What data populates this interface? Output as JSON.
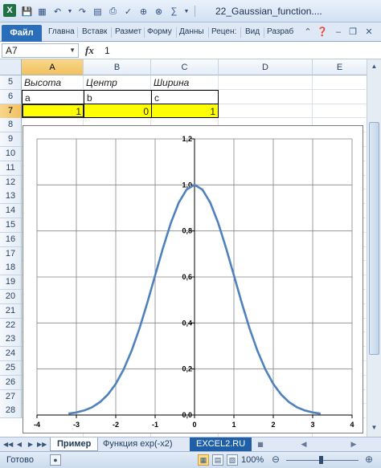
{
  "title_bar": {
    "app_letter": "X",
    "window_title": "22_Gaussian_function....",
    "qat_icons": [
      "save-icon",
      "excel-icon",
      "undo-icon",
      "redo-icon",
      "print-preview-icon",
      "print-icon",
      "spelling-icon",
      "zoom-icon",
      "zoom-alt-icon",
      "formula-icon"
    ]
  },
  "ribbon": {
    "file_tab": "Файл",
    "tabs": [
      "Главна",
      "Вставк",
      "Размет",
      "Форму",
      "Данны",
      "Рецен:",
      "Вид",
      "Разраб"
    ]
  },
  "formula_bar": {
    "name_box": "A7",
    "fx": "fx",
    "value": "1"
  },
  "columns": [
    "A",
    "B",
    "C",
    "D",
    "E"
  ],
  "rows": [
    "5",
    "6",
    "7",
    "8",
    "9",
    "10",
    "11",
    "12",
    "13",
    "14",
    "15",
    "16",
    "17",
    "18",
    "19",
    "20",
    "21",
    "22",
    "23",
    "24",
    "25",
    "26",
    "27",
    "28"
  ],
  "cells": {
    "row5": {
      "a": "Высота",
      "b": "Центр",
      "c": "Ширина"
    },
    "row6": {
      "a": "a",
      "b": "b",
      "c": "c"
    },
    "row7": {
      "a": "1",
      "b": "0",
      "c": "1"
    }
  },
  "chart_data": {
    "type": "line",
    "x_ticks": [
      "-4",
      "-3",
      "-2",
      "-1",
      "0",
      "1",
      "2",
      "3",
      "4"
    ],
    "y_ticks": [
      "0,0",
      "0,2",
      "0,4",
      "0,6",
      "0,8",
      "1,0",
      "1,2"
    ],
    "xlim": [
      -4,
      4
    ],
    "ylim": [
      0,
      1.2
    ],
    "grid": true,
    "series": [
      {
        "color": "#4f81bd",
        "x": [
          -3.2,
          -3.0,
          -2.8,
          -2.6,
          -2.4,
          -2.2,
          -2.0,
          -1.8,
          -1.6,
          -1.4,
          -1.2,
          -1.0,
          -0.8,
          -0.6,
          -0.4,
          -0.2,
          0.0,
          0.2,
          0.4,
          0.6,
          0.8,
          1.0,
          1.2,
          1.4,
          1.6,
          1.8,
          2.0,
          2.2,
          2.4,
          2.6,
          2.8,
          3.0,
          3.2
        ],
        "y": [
          0.006,
          0.011,
          0.02,
          0.034,
          0.056,
          0.089,
          0.135,
          0.198,
          0.278,
          0.375,
          0.487,
          0.607,
          0.726,
          0.835,
          0.923,
          0.98,
          1.0,
          0.98,
          0.923,
          0.835,
          0.726,
          0.607,
          0.487,
          0.375,
          0.278,
          0.198,
          0.135,
          0.089,
          0.056,
          0.034,
          0.02,
          0.011,
          0.006
        ]
      }
    ]
  },
  "sheet_tabs": {
    "active": "Пример",
    "other": "Функция exp(-x2)",
    "ad": "EXCEL2.RU"
  },
  "status_bar": {
    "ready": "Готово",
    "zoom": "100%"
  }
}
